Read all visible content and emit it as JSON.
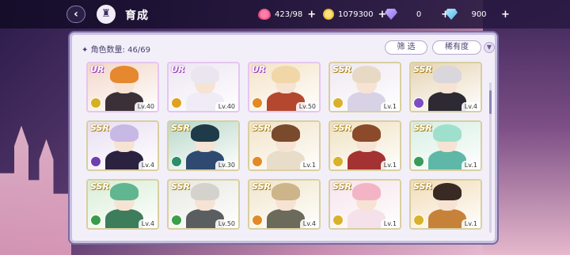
{
  "topbar": {
    "title": "育成",
    "resources": [
      {
        "icon": "candy-icon",
        "value": "423/98"
      },
      {
        "icon": "coin-icon",
        "value": "1079300"
      },
      {
        "icon": "purple-gem-icon",
        "value": "0"
      },
      {
        "icon": "blue-gem-icon",
        "value": "900"
      }
    ]
  },
  "panel": {
    "count_label": "角色数量: 46/69",
    "filter_label": "筛 选",
    "rarity_label": "稀有度"
  },
  "cards": [
    {
      "rarity": "UR",
      "level": "Lv.40",
      "attr_color": "#d6b020",
      "hair": "#e6882e",
      "outfit": "#3a3036",
      "bg": "#f3d7c9"
    },
    {
      "rarity": "UR",
      "level": "Lv.40",
      "attr_color": "#e0a020",
      "hair": "#e9e6ef",
      "outfit": "#f0ecf5",
      "bg": "#ede6f2"
    },
    {
      "rarity": "UR",
      "level": "Lv.50",
      "attr_color": "#e08a20",
      "hair": "#f1d7a8",
      "outfit": "#b4482e",
      "bg": "#f4e3c8"
    },
    {
      "rarity": "SSR",
      "level": "Lv.1",
      "attr_color": "#d9b12a",
      "hair": "#e8d9c4",
      "outfit": "#d8d2e6",
      "bg": "#efe9f2"
    },
    {
      "rarity": "SSR",
      "level": "Lv.4",
      "attr_color": "#7e4cc2",
      "hair": "#d9d6dc",
      "outfit": "#2e2a34",
      "bg": "#e6d4b4"
    },
    {
      "rarity": "SSR",
      "level": "Lv.4",
      "attr_color": "#6f3fb0",
      "hair": "#c8b8e6",
      "outfit": "#2b2240",
      "bg": "#e9dff2"
    },
    {
      "rarity": "SSR",
      "level": "Lv.30",
      "attr_color": "#2c8f6a",
      "hair": "#1f3a48",
      "outfit": "#2f4a70",
      "bg": "#b9d8c9"
    },
    {
      "rarity": "SSR",
      "level": "Lv.1",
      "attr_color": "#e38a25",
      "hair": "#7a4a2c",
      "outfit": "#e7ddc8",
      "bg": "#f1e3c6"
    },
    {
      "rarity": "SSR",
      "level": "Lv.1",
      "attr_color": "#d9b12a",
      "hair": "#8b4a2a",
      "outfit": "#a53232",
      "bg": "#f0e1c0"
    },
    {
      "rarity": "SSR",
      "level": "Lv.1",
      "attr_color": "#3a9b5a",
      "hair": "#9fe0cc",
      "outfit": "#5fb7a8",
      "bg": "#d7efe4"
    },
    {
      "rarity": "SSR",
      "level": "Lv.4",
      "attr_color": "#3a9b4a",
      "hair": "#5fb690",
      "outfit": "#3e7d5c",
      "bg": "#d9eed6"
    },
    {
      "rarity": "SSR",
      "level": "Lv.50",
      "attr_color": "#3aa04a",
      "hair": "#d4d2cc",
      "outfit": "#5a5e60",
      "bg": "#e7e9e2"
    },
    {
      "rarity": "SSR",
      "level": "Lv.4",
      "attr_color": "#e38a25",
      "hair": "#cdb48a",
      "outfit": "#6c6a5a",
      "bg": "#f1e6cc"
    },
    {
      "rarity": "SSR",
      "level": "Lv.1",
      "attr_color": "#d9b12a",
      "hair": "#f3b5c6",
      "outfit": "#f5e1ea",
      "bg": "#f6e4ec"
    },
    {
      "rarity": "SSR",
      "level": "Lv.1",
      "attr_color": "#d9b12a",
      "hair": "#3a2a24",
      "outfit": "#c7823a",
      "bg": "#f2dcb7"
    }
  ]
}
